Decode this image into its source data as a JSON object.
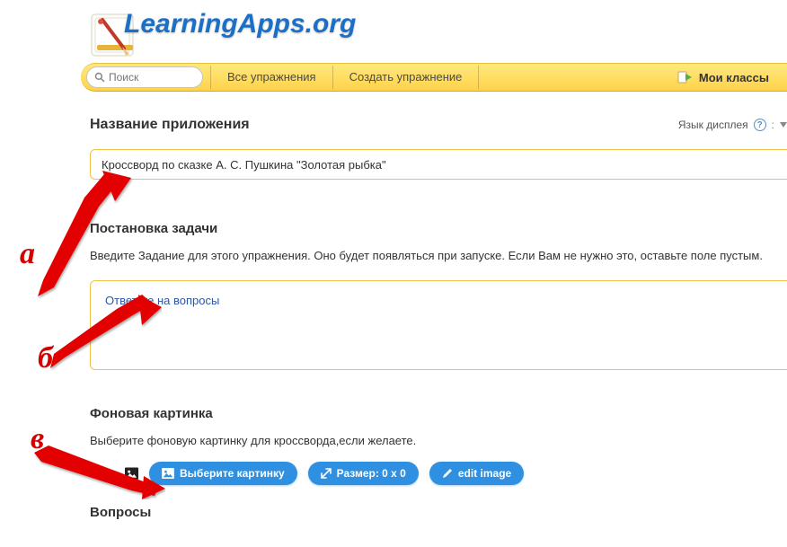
{
  "logo": {
    "text": "LearningApps.org"
  },
  "nav": {
    "search_placeholder": "Поиск",
    "all": "Все упражнения",
    "create": "Создать упражнение",
    "my_classes": "Мои классы"
  },
  "section_app_title": {
    "heading": "Название приложения",
    "display_lang": "Язык дисплея",
    "value": "Кроссворд по сказке А. С. Пушкина \"Золотая рыбка\""
  },
  "section_task": {
    "heading": "Постановка задачи",
    "help": "Введите Задание для этого упражнения. Оно будет появляться при запуске. Если Вам не нужно это, оставьте поле пустым.",
    "value": "Ответьте на вопросы"
  },
  "section_bg": {
    "heading": "Фоновая картинка",
    "help": "Выберите фоновую картинку для кроссворда,если желаете.",
    "btn_choose": "Выберите картинку",
    "btn_size": "Размер: 0 x 0",
    "btn_edit": "edit image"
  },
  "section_questions": {
    "heading": "Вопросы"
  },
  "annotations": {
    "a": "а",
    "b": "б",
    "c": "в"
  }
}
